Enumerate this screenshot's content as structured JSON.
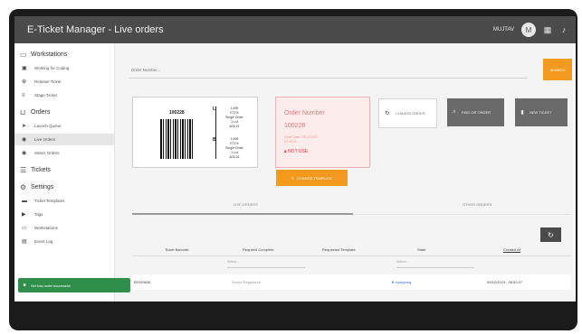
{
  "app": {
    "title": "E-Ticket Manager - Live orders"
  },
  "header": {
    "user_name": "MUJTAV",
    "avatar_initial": "M"
  },
  "sidebar": {
    "sections": [
      {
        "label": "Workstations",
        "icon": "monitor-icon",
        "items": [
          {
            "label": "Working for Coding",
            "icon": "desktop-icon"
          },
          {
            "label": "Release Ticket",
            "icon": "upload-icon"
          },
          {
            "label": "Stage Ticket",
            "icon": "layers-icon"
          }
        ]
      },
      {
        "label": "Orders",
        "icon": "orders-icon",
        "items": [
          {
            "label": "Launch Queue",
            "icon": "send-icon"
          },
          {
            "label": "Live Orders",
            "icon": "live-icon",
            "active": true
          },
          {
            "label": "Select Orders",
            "icon": "select-icon"
          }
        ]
      },
      {
        "label": "Tickets",
        "icon": "tickets-icon",
        "items": []
      },
      {
        "label": "Settings",
        "icon": "gear-icon",
        "items": [
          {
            "label": "Ticket Templates",
            "icon": "template-icon"
          },
          {
            "label": "Tags",
            "icon": "tag-icon"
          },
          {
            "label": "Workstations",
            "icon": "workstation-icon"
          },
          {
            "label": "Event Log",
            "icon": "log-icon"
          }
        ]
      }
    ]
  },
  "search": {
    "placeholder": "Order Number...",
    "button_label": "SEARCH"
  },
  "ticket": {
    "number": "100228",
    "section_a": "L",
    "section_b": "B",
    "info_a": [
      "1,695",
      "E71%",
      "Single Order",
      "1 Lot",
      "A03-01"
    ],
    "info_b": [
      "1,695",
      "E71%",
      "Single Order",
      "1 Lot",
      "A03-01"
    ]
  },
  "order": {
    "label": "Order Number",
    "number": "100228",
    "date_line1": "Order Date: 09/12/2023",
    "date_line2": "09:09:25",
    "status": "NOT USE"
  },
  "buttons": {
    "change_template": "CHANGE TEMPLATE",
    "change_order": "CHANGE ORDER",
    "find_order": "FIND OR ORDER",
    "new_ticket": "NEW TICKET"
  },
  "tabs": [
    {
      "label": "LIVE ORDERS"
    },
    {
      "label": "OTHER ORDERS"
    }
  ],
  "table": {
    "headers": [
      "Ticket Barcode",
      "Required Complete",
      "Requested Template",
      "State",
      "Created At"
    ],
    "filters": [
      "Select...",
      "Select..."
    ],
    "rows": [
      {
        "barcode": "BF093636",
        "required": "Sound Registered",
        "template": "",
        "state": "Assigning",
        "created": "09/12/2023 - 08:52:07"
      }
    ]
  },
  "toast": {
    "message": "Set has order successful"
  },
  "colors": {
    "accent": "#f39a1e",
    "topbar": "#4b4b4b",
    "success": "#2f8f4a",
    "error": "#e07c7c"
  }
}
